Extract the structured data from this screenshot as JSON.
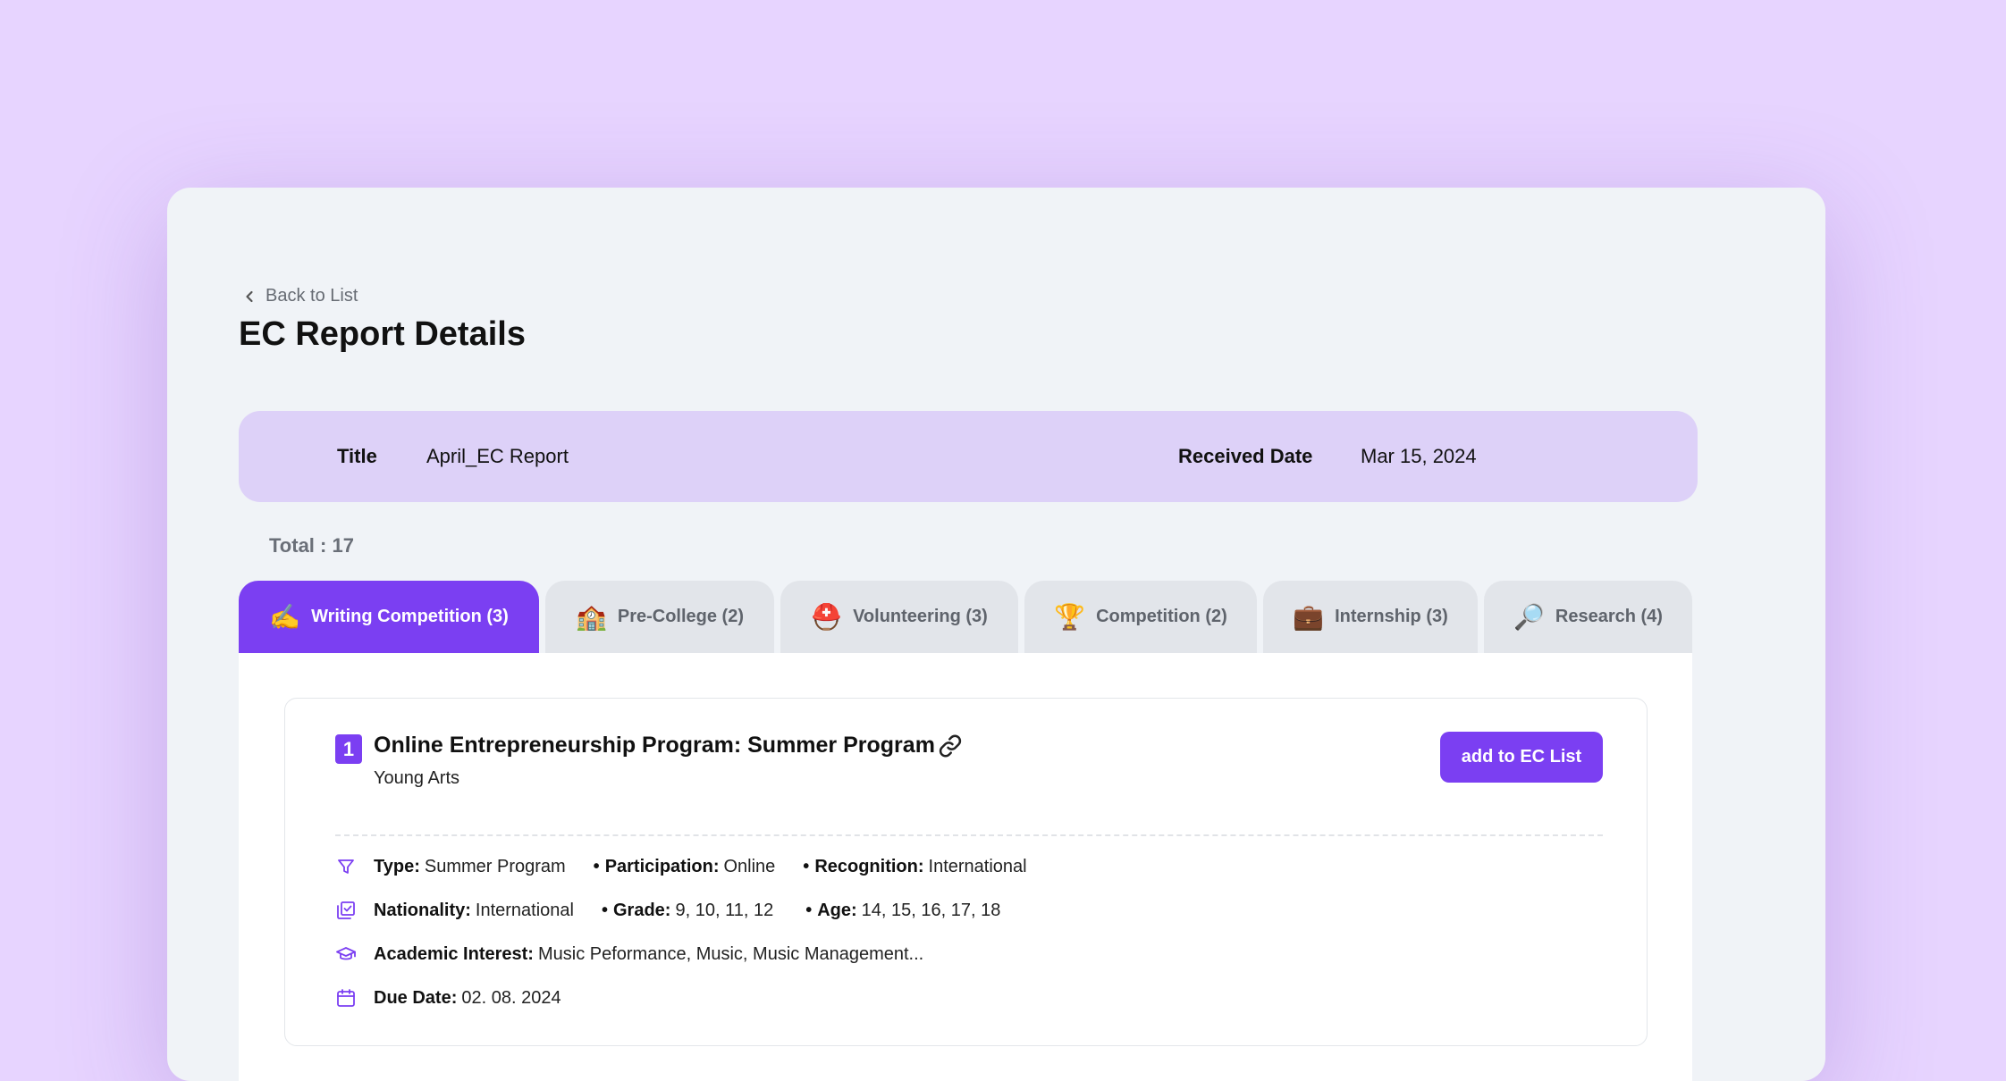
{
  "header": {
    "back_label": "Back to List",
    "page_title": "EC Report Details"
  },
  "report": {
    "title_label": "Title",
    "title_value": "April_EC Report",
    "date_label": "Received Date",
    "date_value": "Mar 15, 2024"
  },
  "total_label": "Total : 17",
  "tabs": [
    {
      "emoji": "✍️",
      "label": "Writing Competition (3)",
      "active": true
    },
    {
      "emoji": "🏫",
      "label": "Pre-College (2)",
      "active": false
    },
    {
      "emoji": "⛑️",
      "label": "Volunteering (3)",
      "active": false
    },
    {
      "emoji": "🏆",
      "label": "Competition (2)",
      "active": false
    },
    {
      "emoji": "💼",
      "label": "Internship (3)",
      "active": false
    },
    {
      "emoji": "🔎",
      "label": "Research (4)",
      "active": false
    }
  ],
  "card": {
    "number": "1",
    "title": "Online Entrepreneurship Program: Summer Program",
    "organization": "Young Arts",
    "add_button": "add to EC List",
    "type_label": "Type:",
    "type_value": "Summer Program",
    "participation_label": "Participation:",
    "participation_value": "Online",
    "recognition_label": "Recognition:",
    "recognition_value": "International",
    "nationality_label": "Nationality:",
    "nationality_value": "International",
    "grade_label": "Grade:",
    "grade_value": "9, 10, 11, 12",
    "age_label": "Age:",
    "age_value": "14, 15, 16, 17, 18",
    "interest_label": "Academic Interest:",
    "interest_value": "Music Peformance, Music, Music Management...",
    "due_label": "Due Date:",
    "due_value": "02. 08. 2024"
  },
  "colors": {
    "page_bg": "#e7d4ff",
    "accent": "#7b3ff2",
    "info_bar": "#ddd1f8",
    "tab_inactive": "#e2e5ea"
  },
  "icons": [
    "chevron-left-icon",
    "link-icon",
    "filter-icon",
    "checklist-icon",
    "graduation-cap-icon",
    "calendar-icon"
  ]
}
